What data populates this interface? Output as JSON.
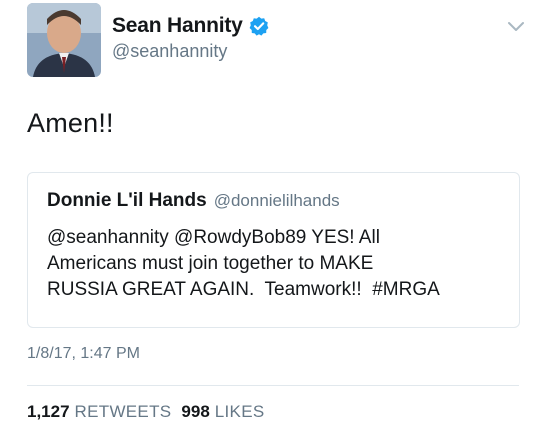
{
  "tweet": {
    "author": {
      "display_name": "Sean Hannity",
      "handle": "@seanhannity",
      "verified": true
    },
    "text": "Amen!!",
    "timestamp": "1/8/17, 1:47 PM",
    "stats": {
      "retweets_count": "1,127",
      "retweets_label": "RETWEETS",
      "likes_count": "998",
      "likes_label": "LIKES"
    }
  },
  "quoted_tweet": {
    "display_name": "Donnie L'il Hands",
    "handle": "@donnielilhands",
    "text_lines": [
      "@seanhannity @RowdyBob89 YES! All",
      "Americans must join together to MAKE",
      "RUSSIA GREAT AGAIN.  Teamwork!!  #MRGA"
    ]
  },
  "icons": {
    "verified": "verified-badge-icon",
    "menu": "chevron-down-icon"
  },
  "colors": {
    "primary_text": "#14171a",
    "secondary_text": "#657786",
    "border": "#e1e8ed",
    "verified_blue": "#1da1f2"
  }
}
